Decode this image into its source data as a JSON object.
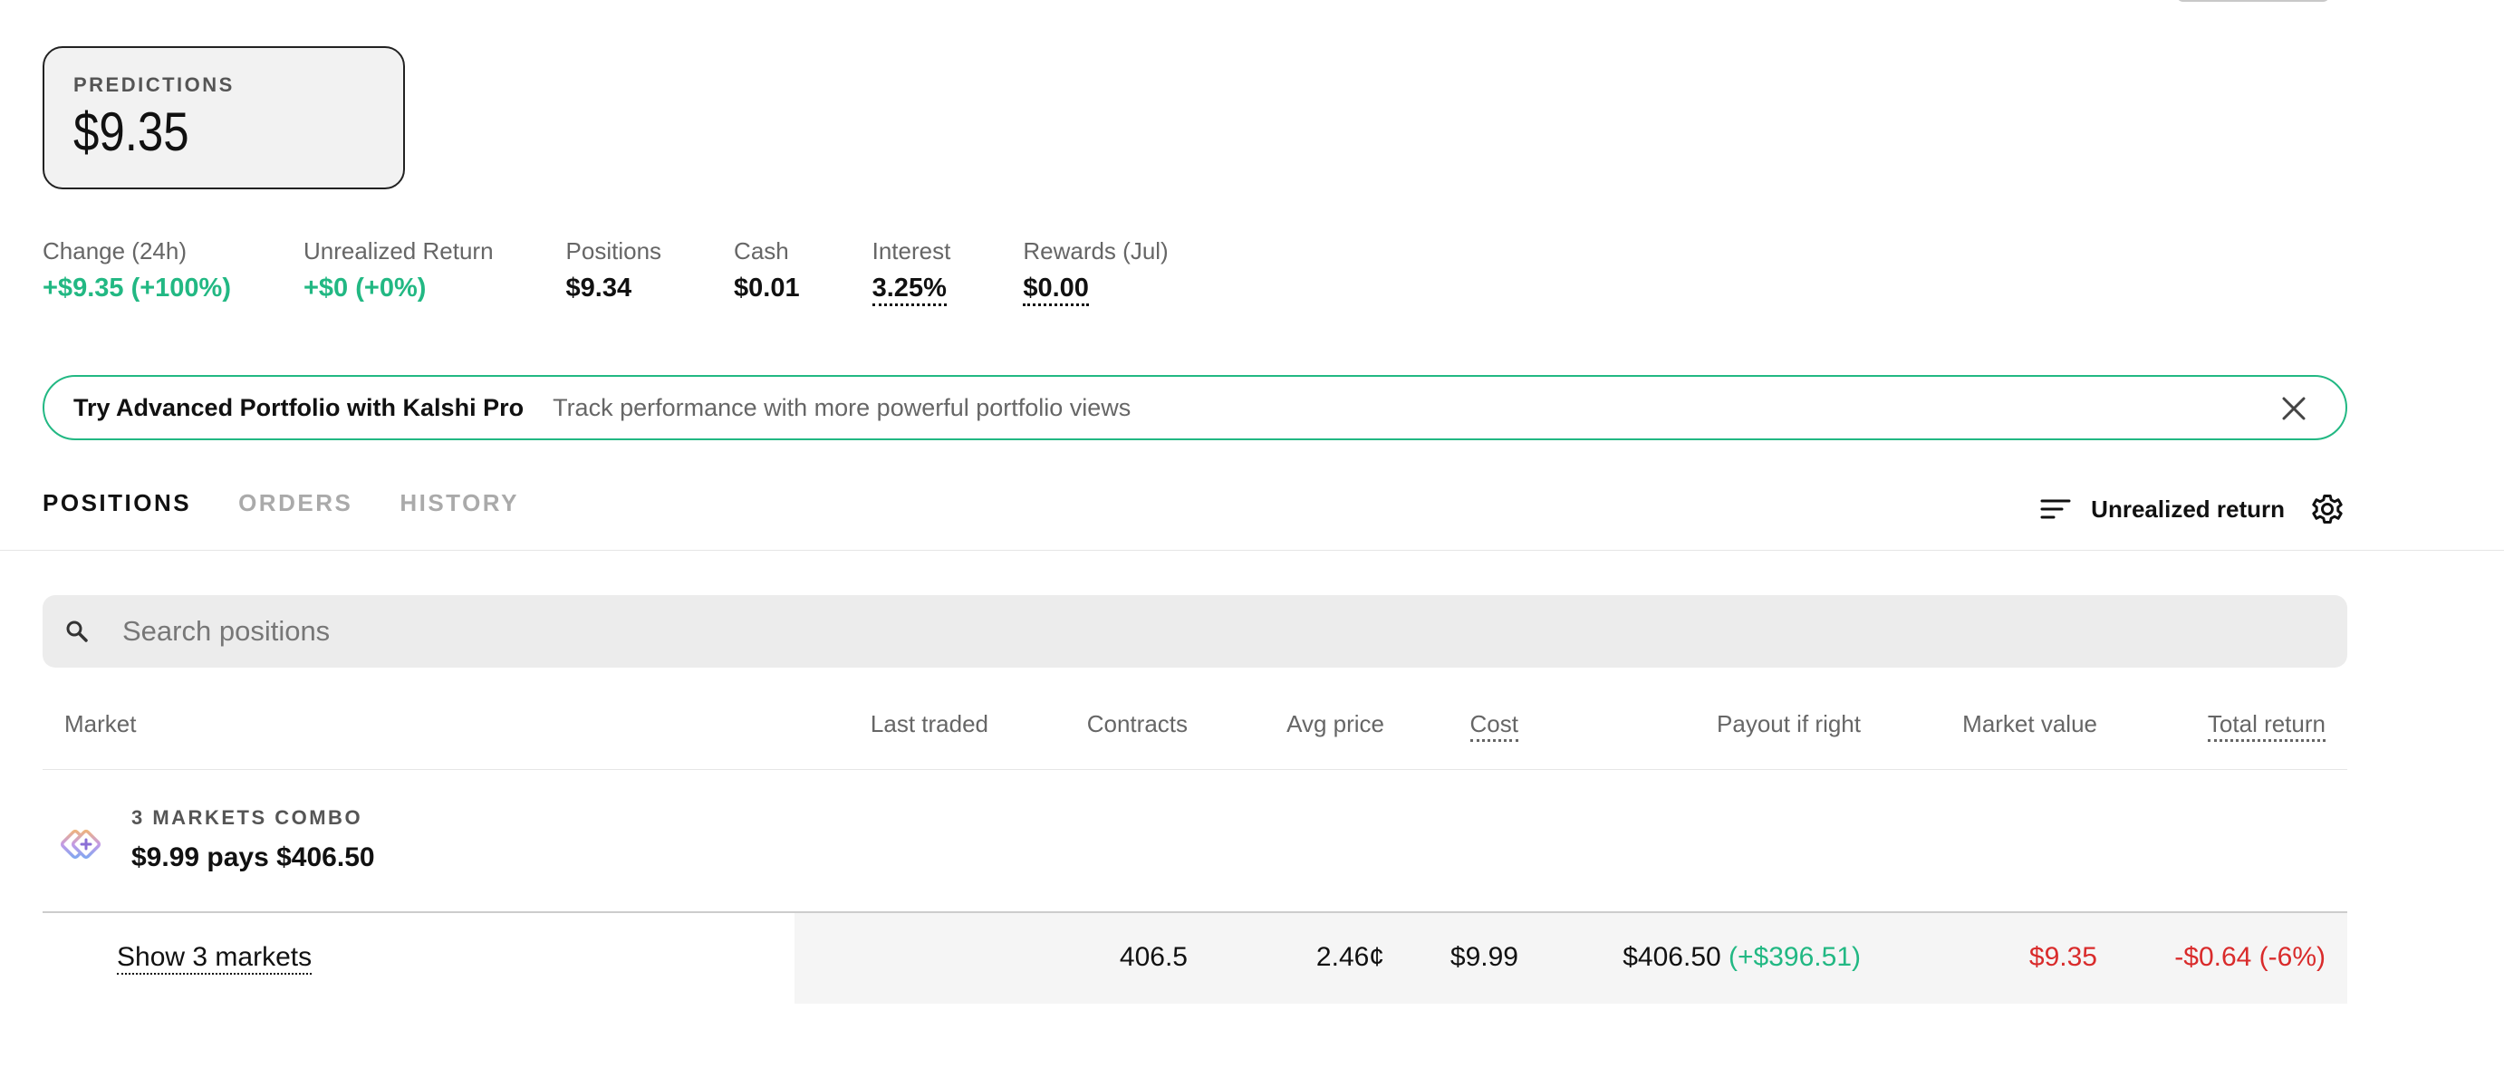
{
  "predictions": {
    "label": "PREDICTIONS",
    "value": "$9.35"
  },
  "stats": [
    {
      "label": "Change (24h)",
      "value": "+$9.35 (+100%)"
    },
    {
      "label": "Unrealized Return",
      "value": "+$0 (+0%)"
    },
    {
      "label": "Positions",
      "value": "$9.34"
    },
    {
      "label": "Cash",
      "value": "$0.01"
    },
    {
      "label": "Interest",
      "value": "3.25%"
    },
    {
      "label": "Rewards (Jul)",
      "value": "$0.00"
    }
  ],
  "banner": {
    "title": "Try Advanced Portfolio with Kalshi Pro",
    "subtitle": "Track performance with more powerful portfolio views"
  },
  "tabs": [
    {
      "label": "POSITIONS",
      "active": true
    },
    {
      "label": "ORDERS",
      "active": false
    },
    {
      "label": "HISTORY",
      "active": false
    }
  ],
  "sort": {
    "label": "Unrealized return",
    "icon": "sort-lines-icon"
  },
  "search": {
    "placeholder": "Search positions",
    "value": ""
  },
  "table": {
    "columns": {
      "market": "Market",
      "last_traded": "Last traded",
      "contracts": "Contracts",
      "avg_price": "Avg price",
      "cost": "Cost",
      "payout": "Payout if right",
      "market_value": "Market value",
      "total_return": "Total return"
    },
    "combo": {
      "label": "3 MARKETS COMBO",
      "title": "$9.99 pays $406.50"
    },
    "row": {
      "link": "Show 3 markets",
      "last_traded": "",
      "contracts": "406.5",
      "avg_price": "2.46¢",
      "cost": "$9.99",
      "payout": "$406.50",
      "payout_gain": "(+$396.51)",
      "market_value": "$9.35",
      "total_return": "-$0.64 (-6%)"
    }
  },
  "colors": {
    "positive": "#22b883",
    "negative": "#d92b2b",
    "accent_border": "#22b883"
  }
}
